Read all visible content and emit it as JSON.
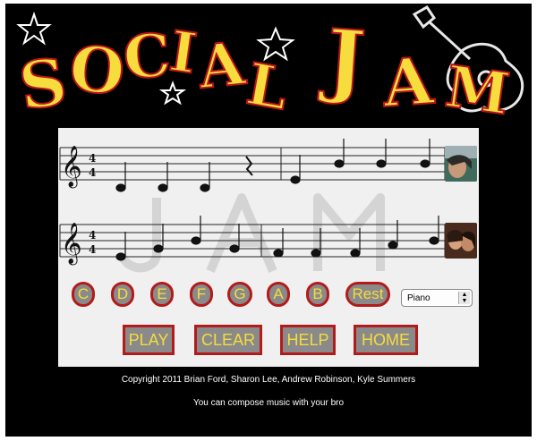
{
  "header": {
    "title_letters": [
      "S",
      "O",
      "C",
      "I",
      "A",
      "L",
      "J",
      "A",
      "M"
    ]
  },
  "notes": [
    "C",
    "D",
    "E",
    "F",
    "G",
    "A",
    "B",
    "Rest"
  ],
  "instrument": {
    "selected": "Piano"
  },
  "commands": [
    "PLAY",
    "CLEAR",
    "HELP",
    "HOME"
  ],
  "footer": {
    "copyright": "Copyright 2011 Brian Ford, Sharon Lee, Andrew Robinson, Kyle Summers",
    "tagline": "You can compose music with your bro"
  },
  "staff": {
    "time_signature": [
      "4",
      "4"
    ]
  },
  "colors": {
    "accent_yellow": "#f6dc3c",
    "accent_red": "#b31b1b",
    "button_gray": "#8a8a8a"
  }
}
